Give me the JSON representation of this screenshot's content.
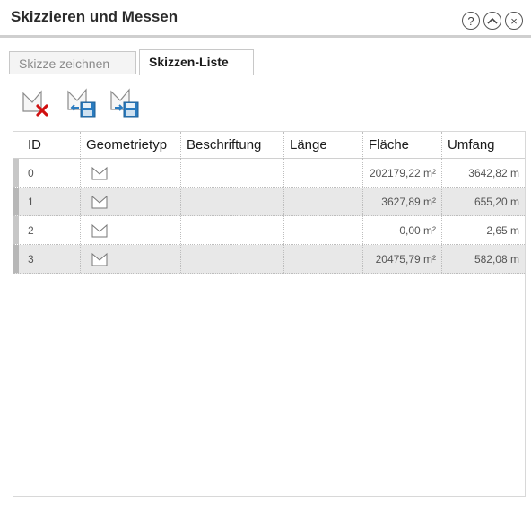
{
  "window": {
    "title": "Skizzieren und Messen",
    "help_icon": "?",
    "collapse_icon": "^",
    "close_icon": "×"
  },
  "tabs": [
    {
      "label": "Skizze zeichnen",
      "active": false
    },
    {
      "label": "Skizzen-Liste",
      "active": true
    }
  ],
  "toolbar": {
    "buttons": [
      {
        "icon": "delete-sketch-icon"
      },
      {
        "icon": "import-sketch-icon"
      },
      {
        "icon": "export-sketch-icon"
      }
    ]
  },
  "table": {
    "columns": [
      "ID",
      "Geometrietyp",
      "Beschriftung",
      "Länge",
      "Fläche",
      "Umfang"
    ],
    "rows": [
      {
        "id": "0",
        "geometry_icon": "polygon-icon",
        "label": "",
        "length": "",
        "area": "202179,22 m²",
        "perimeter": "3642,82 m"
      },
      {
        "id": "1",
        "geometry_icon": "polygon-icon",
        "label": "",
        "length": "",
        "area": "3627,89 m²",
        "perimeter": "655,20 m"
      },
      {
        "id": "2",
        "geometry_icon": "polygon-icon",
        "label": "",
        "length": "",
        "area": "0,00 m²",
        "perimeter": "2,65 m"
      },
      {
        "id": "3",
        "geometry_icon": "polygon-icon",
        "label": "",
        "length": "",
        "area": "20475,79 m²",
        "perimeter": "582,08 m"
      }
    ]
  },
  "colors": {
    "row_alt": "#e8e8e8",
    "delete_accent": "#d01010",
    "disk_accent": "#2a7bbf"
  }
}
